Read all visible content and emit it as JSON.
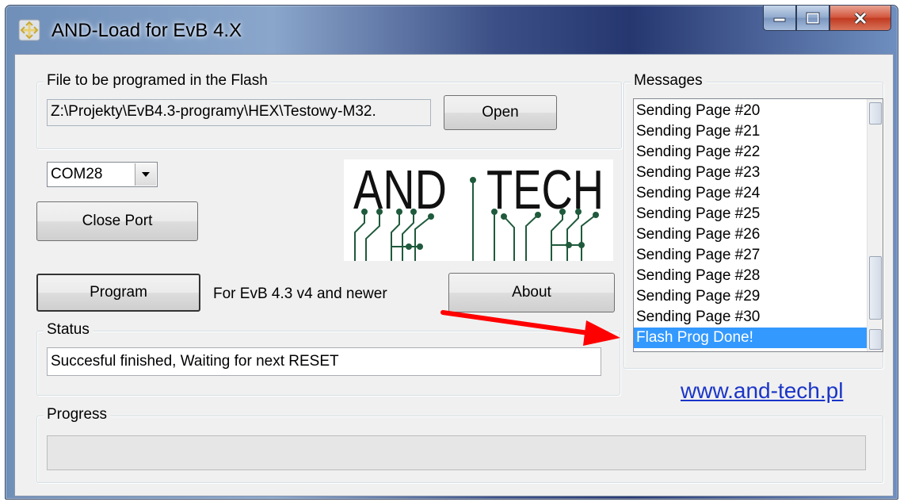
{
  "window": {
    "title": "AND-Load for EvB 4.X",
    "caption_buttons": [
      "minimize-icon",
      "maximize-icon",
      "close-icon"
    ]
  },
  "file_group": {
    "label": "File to be programed in the Flash",
    "path_value": "Z:\\Projekty\\EvB4.3-programy\\HEX\\Testowy-M32.",
    "open_button": "Open"
  },
  "port": {
    "selected": "COM28",
    "close_button": "Close Port"
  },
  "logo": {
    "text_left": "AND",
    "text_right": "TECH",
    "color": "#1f5a3c"
  },
  "program_button": "Program",
  "version_note": "For EvB 4.3 v4 and newer",
  "about_button": "About",
  "status_group": {
    "label": "Status",
    "value": "Succesful finished, Waiting for next RESET"
  },
  "messages_group": {
    "label": "Messages",
    "items": [
      "Sending Page #20",
      "Sending Page #21",
      "Sending Page #22",
      "Sending Page #23",
      "Sending Page #24",
      "Sending Page #25",
      "Sending Page #26",
      "Sending Page #27",
      "Sending Page #28",
      "Sending Page #29",
      "Sending Page #30",
      "Flash Prog Done!"
    ],
    "selected_index": 11
  },
  "website_link": "www.and-tech.pl",
  "progress_group": {
    "label": "Progress",
    "value": 0
  },
  "colors": {
    "selection": "#3399ff",
    "link": "#1a35c8",
    "annotation_arrow": "#ff0000"
  }
}
